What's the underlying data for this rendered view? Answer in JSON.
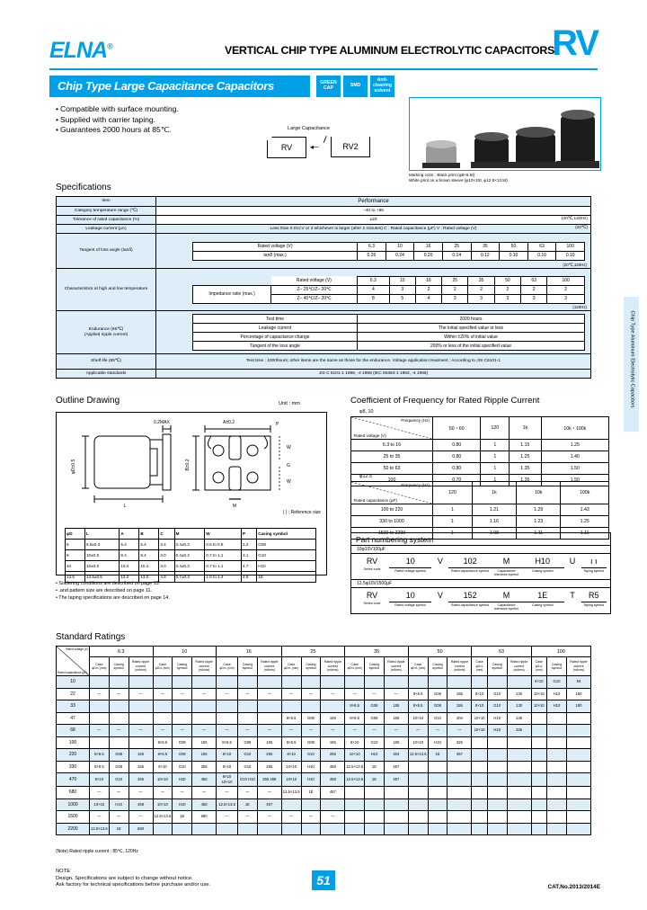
{
  "header": {
    "logo": "ELNA",
    "logo_sup": "®",
    "title": "VERTICAL CHIP TYPE ALUMINUM ELECTROLYTIC CAPACITORS",
    "series": "RV",
    "banner": "Chip Type Large Capacitance Capacitors",
    "badges": [
      "GREEN CAP",
      "SMD",
      "Anti-cleaning solvent"
    ],
    "accent_color": "#00a0e9"
  },
  "features": [
    "Compatible with surface mounting.",
    "Supplied with carrier taping.",
    "Guarantees 2000 hours at 85℃."
  ],
  "series_map": {
    "caption": "Large Capacitance",
    "left": "RV",
    "right": "RV2"
  },
  "photo_note": [
    "Marking color : Black print (φ8×6.5ℓ)",
    "White print on a brown sleeve (φ10×10ℓ, φ12.5×13.5ℓ)"
  ],
  "side_tab": "Chip Type Aluminum Electrolytic Capacitors",
  "specifications": {
    "title": "Specifications",
    "col_item": "Item",
    "col_perf": "Performance",
    "rows": [
      {
        "item": "Category temperature range (℃)",
        "value": "–40 to +85"
      },
      {
        "item": "Tolerance of rated capacitance (%)",
        "value": "±20",
        "right": "(20℃,120Hz)"
      },
      {
        "item": "Leakage current (μA)",
        "value": "Less than 0.01CV or 3 whichever is larger (after 2 minutes)  C : Rated capacitance (μF)   V : Rated voltage (V)",
        "right": "(20℃)"
      }
    ],
    "tand": {
      "item": "Tangent of loss angle (tanδ)",
      "row1_label": "Rated voltage (V)",
      "row2_label": "tanδ (max.)",
      "voltages": [
        "6.3",
        "10",
        "16",
        "25",
        "35",
        "50",
        "63",
        "100"
      ],
      "values": [
        "0.26",
        "0.24",
        "0.20",
        "0.14",
        "0.12",
        "0.10",
        "0.10",
        "0.10"
      ],
      "note": "(20℃,120Hz)"
    },
    "lowtemp": {
      "item": "Characteristics at high and low temperature",
      "row_label": "Rated voltage (V)",
      "z_label": "Impedance ratio (max.)",
      "z1": "Z– 25℃/Z– 20℃",
      "z2": "Z– 40℃/Z– 20℃",
      "voltages": [
        "6.3",
        "10",
        "16",
        "25",
        "35",
        "50",
        "63",
        "100"
      ],
      "values1": [
        "4",
        "3",
        "2",
        "2",
        "2",
        "2",
        "2",
        "2"
      ],
      "values2": [
        "8",
        "5",
        "4",
        "3",
        "3",
        "3",
        "3",
        "3"
      ],
      "note": "(120Hz)"
    },
    "endurance": {
      "item": "Endurance (85℃)",
      "item2": "(Applied ripple current)",
      "rows": [
        {
          "k": "Test time",
          "v": "2000 hours"
        },
        {
          "k": "Leakage current",
          "v": "The initial specified value or less"
        },
        {
          "k": "Percentage of capacitance change",
          "v": "Within ±20% of initial value"
        },
        {
          "k": "Tangent of the loss angle",
          "v": "200% or less of the initial specified value"
        }
      ]
    },
    "shelf": {
      "item": "Shelf life (85℃)",
      "value": "Test time : 1000hours; other items are the same as those for the endurance. Voltage application treatment : According to JIS C5101-1"
    },
    "standards": {
      "item": "Applicable standards",
      "value": "JIS C 5101-1 1998, -4 1998 (IEC 60384-1 1982, -4 1985)"
    }
  },
  "outline": {
    "title": "Outline Drawing",
    "unit": "Unit : mm",
    "ref_note": "( ) : Reference size",
    "labels": {
      "t_max": "0.2MAX",
      "a_tol": "A±0.2",
      "phid": "φD±0.5",
      "b": "B±0.2",
      "l": "L",
      "p": "P",
      "m": "M",
      "w": "W",
      "g": "G"
    },
    "table": {
      "headers": [
        "φD",
        "L",
        "A",
        "B",
        "C",
        "M",
        "W",
        "P",
        "Casing symbol"
      ],
      "rows": [
        [
          "5",
          "6.5±0.3",
          "5.4",
          "5.4",
          "3.4",
          "0.4±0.2",
          "0.5 to 0.8",
          "2.2",
          "G08"
        ],
        [
          "8",
          "10±0.5",
          "8.4",
          "8.4",
          "3.0",
          "0.4±0.2",
          "0.7 to 1.1",
          "3.1",
          "G10"
        ],
        [
          "10",
          "10±0.5",
          "10.4",
          "10.4",
          "3.0",
          "0.4±0.2",
          "0.7 to 1.1",
          "4.7",
          "H10"
        ],
        [
          "12.5",
          "13.5±0.5",
          "13.0",
          "13.0",
          "4.9",
          "0.7±0.3",
          "1.0 to 1.4",
          "4.6",
          "1E"
        ]
      ]
    }
  },
  "footnotes": [
    "• Soldering conditions are described on page 13.",
    "• .and pattern size are described on page 11.",
    "• The taping specifications are described on page 14."
  ],
  "coefficient": {
    "title": "Coefficient of Frequency for Rated Ripple Current",
    "table1": {
      "caption": "φ8, 10",
      "corner_freq": "Frequency (Hz)",
      "corner_rated": "Rated voltage (V)",
      "columns": [
        "50・60",
        "120",
        "1k",
        "10k・100k"
      ],
      "rows": [
        {
          "label": "6.3 to 16",
          "values": [
            "0.80",
            "1",
            "1.15",
            "1.25"
          ]
        },
        {
          "label": "25 to 35",
          "values": [
            "0.80",
            "1",
            "1.25",
            "1.40"
          ]
        },
        {
          "label": "50 to 63",
          "values": [
            "0.80",
            "1",
            "1.35",
            "1.50"
          ]
        },
        {
          "label": "100",
          "values": [
            "0.70",
            "1",
            "1.35",
            "1.50"
          ]
        }
      ]
    },
    "table2": {
      "caption": "φ12.5",
      "corner_freq": "Frequency (Hz)",
      "corner_rated": "Rated capacitance (μF)",
      "columns": [
        "120",
        "1k",
        "10k",
        "100k"
      ],
      "rows": [
        {
          "label": "100 to 220",
          "values": [
            "1",
            "1.21",
            "1.29",
            "1.43"
          ]
        },
        {
          "label": "330 to 1000",
          "values": [
            "1",
            "1.16",
            "1.23",
            "1.25"
          ]
        },
        {
          "label": "1500 to 2200",
          "values": [
            "1",
            "1.08",
            "1.11",
            "1.11"
          ]
        }
      ]
    }
  },
  "part_numbering": {
    "title": "Part numbering system",
    "example1": {
      "caption": "10φ10V100μF",
      "codes": [
        "RV",
        "10",
        "V",
        "102",
        "M",
        "H10",
        "U",
        "ı ı"
      ],
      "labels": [
        "Series code",
        "Rated voltage symbol",
        "Rated capacitance symbol",
        "Capacitance tolerance symbol",
        "Casing symbol",
        "",
        "Taping symbol"
      ]
    },
    "example2": {
      "caption": "12.5φ10V1500μF",
      "codes": [
        "RV",
        "10",
        "V",
        "152",
        "M",
        "1E",
        "T",
        "R5"
      ],
      "labels": [
        "Series code",
        "Rated voltage symbol",
        "Rated capacitance symbol",
        "Capacitance tolerance symbol",
        "Casing symbol",
        "",
        "Taping symbol"
      ]
    }
  },
  "ratings": {
    "title": "Standard Ratings",
    "corner_top": "Rated voltage (V)",
    "corner_bottom": "Rated capacitance (μF)",
    "corner_item": "Item",
    "voltages": [
      "6.3",
      "10",
      "16",
      "25",
      "35",
      "50",
      "63",
      "100"
    ],
    "subheaders": [
      "Case",
      "Casing symbol",
      "Rated ripple current"
    ],
    "subunits": [
      "φD×L (mm)",
      "",
      "(mArms)"
    ],
    "capacitances": [
      "10",
      "22",
      "33",
      "47",
      "68",
      "100",
      "220",
      "330",
      "470",
      "680",
      "1000",
      "1500",
      "2200"
    ],
    "note": "(Note) Rated ripple current : 85℃, 120Hz",
    "data": [
      {
        "cap": "10",
        "cells": [
          [
            "",
            "",
            " "
          ],
          [
            "",
            "",
            " "
          ],
          [
            "",
            "",
            " "
          ],
          [
            "",
            "",
            " "
          ],
          [
            "",
            "",
            " "
          ],
          [
            "",
            "",
            " "
          ],
          [
            "",
            "",
            " "
          ],
          [
            "8×10",
            "G10",
            "94"
          ]
        ]
      },
      {
        "cap": "22",
        "cells": [
          [
            "—",
            "—",
            "—"
          ],
          [
            "—",
            "—",
            "—"
          ],
          [
            "—",
            "—",
            "—"
          ],
          [
            "—",
            "—",
            "—"
          ],
          [
            "—",
            "—",
            "—"
          ],
          [
            "8×6.5",
            "G08",
            "155"
          ],
          [
            "8×10",
            "G10",
            "130"
          ],
          [
            "10×10",
            "H10",
            "180"
          ]
        ]
      },
      {
        "cap": "33",
        "cells": [
          [
            "",
            "",
            " "
          ],
          [
            "",
            "",
            " "
          ],
          [
            "",
            "",
            " "
          ],
          [
            "",
            "",
            " "
          ],
          [
            "8×6.5",
            "G08",
            "155"
          ],
          [
            "8×6.5",
            "G08",
            "155"
          ],
          [
            "8×10",
            "G10",
            "130"
          ],
          [
            "10×10",
            "H10",
            "180"
          ]
        ]
      },
      {
        "cap": "47",
        "cells": [
          [
            "",
            "",
            " "
          ],
          [
            "",
            "",
            " "
          ],
          [
            "",
            "",
            " "
          ],
          [
            "8×6.5",
            "G08",
            "155"
          ],
          [
            "8×6.5",
            "G08",
            "155"
          ],
          [
            "10×10",
            "G10",
            "404"
          ],
          [
            "10×10",
            "H10",
            "245"
          ],
          [
            "",
            "",
            " "
          ]
        ]
      },
      {
        "cap": "68",
        "cells": [
          [
            "—",
            "—",
            "—"
          ],
          [
            "—",
            "—",
            "—"
          ],
          [
            "—",
            "—",
            "—"
          ],
          [
            "—",
            "—",
            "—"
          ],
          [
            "—",
            "—",
            "—"
          ],
          [
            "—",
            "—",
            "—"
          ],
          [
            "10×10",
            "H10",
            "325"
          ],
          [
            "",
            "",
            " "
          ]
        ]
      },
      {
        "cap": "100",
        "cells": [
          [
            "",
            "",
            " "
          ],
          [
            "8×6.5",
            "G08",
            "155"
          ],
          [
            "8×6.5",
            "G08",
            "155"
          ],
          [
            "8×6.5",
            "G08",
            "155"
          ],
          [
            "8×10",
            "G10",
            "180"
          ],
          [
            "10×10",
            "H10",
            "325"
          ],
          [
            "",
            "",
            " "
          ],
          [
            "",
            "",
            " "
          ]
        ]
      },
      {
        "cap": "220",
        "cells": [
          [
            "8×6.5",
            "G08",
            "155"
          ],
          [
            "8×6.5",
            "G08",
            "155"
          ],
          [
            "8×10",
            "G10",
            "255"
          ],
          [
            "8×10",
            "G10",
            "255"
          ],
          [
            "10×10",
            "H10",
            "404"
          ],
          [
            "12.5×13.5",
            "1E",
            "457"
          ],
          [
            "",
            "",
            " "
          ],
          [
            "",
            "",
            " "
          ]
        ]
      },
      {
        "cap": "330",
        "cells": [
          [
            "8×6.5",
            "G08",
            "155"
          ],
          [
            "8×10",
            "G10",
            "255"
          ],
          [
            "8×10",
            "G10",
            "255"
          ],
          [
            "10×10",
            "H10",
            "458"
          ],
          [
            "12.5×13.5",
            "1E",
            "457"
          ],
          [
            "",
            "",
            " "
          ],
          [
            "",
            "",
            " "
          ],
          [
            "",
            "",
            " "
          ]
        ]
      },
      {
        "cap": "470",
        "cells": [
          [
            "8×10",
            "G10",
            "255"
          ],
          [
            "10×10",
            "H10",
            "458"
          ],
          [
            "8×10 10×10",
            "G10 H10",
            "255 458"
          ],
          [
            "10×10",
            "H10",
            "458"
          ],
          [
            "12.5×13.5",
            "1E",
            "457"
          ],
          [
            "",
            "",
            " "
          ],
          [
            "",
            "",
            " "
          ],
          [
            "",
            "",
            " "
          ]
        ]
      },
      {
        "cap": "680",
        "cells": [
          [
            "—",
            "—",
            "—"
          ],
          [
            "—",
            "—",
            "—"
          ],
          [
            "—",
            "—",
            "—"
          ],
          [
            "12.5×13.5",
            "1E",
            "457"
          ],
          [
            "",
            "",
            " "
          ],
          [
            "",
            "",
            " "
          ],
          [
            "",
            "",
            " "
          ],
          [
            "",
            "",
            " "
          ]
        ]
      },
      {
        "cap": "1000",
        "cells": [
          [
            "10×10",
            "H10",
            "458"
          ],
          [
            "10×10",
            "H10",
            "458"
          ],
          [
            "12.5×13.5",
            "1E",
            "457"
          ],
          [
            "",
            "",
            " "
          ],
          [
            "",
            "",
            " "
          ],
          [
            "",
            "",
            " "
          ],
          [
            "",
            "",
            " "
          ],
          [
            "",
            "",
            " "
          ]
        ]
      },
      {
        "cap": "1500",
        "cells": [
          [
            "—",
            "—",
            "—"
          ],
          [
            "12.5×13.5",
            "1E",
            "580"
          ],
          [
            "—",
            "—",
            "—"
          ],
          [
            "—",
            "—",
            "—"
          ],
          [
            "",
            "",
            " "
          ],
          [
            "",
            "",
            " "
          ],
          [
            "",
            "",
            " "
          ],
          [
            "",
            "",
            " "
          ]
        ]
      },
      {
        "cap": "2200",
        "cells": [
          [
            "12.5×13.5",
            "1E",
            "680"
          ],
          [
            "",
            "",
            " "
          ],
          [
            "",
            "",
            " "
          ],
          [
            "",
            "",
            " "
          ],
          [
            "",
            "",
            " "
          ],
          [
            "",
            "",
            " "
          ],
          [
            "",
            "",
            " "
          ],
          [
            "",
            "",
            " "
          ]
        ]
      }
    ]
  },
  "footer": {
    "note_title": "NOTE",
    "note_lines": [
      "Design, Specifications are subject to change without notice.",
      "Ask factory for technical specifications before purchase and/or use."
    ],
    "page": "51",
    "catno": "CAT.No.2013/2014E"
  }
}
